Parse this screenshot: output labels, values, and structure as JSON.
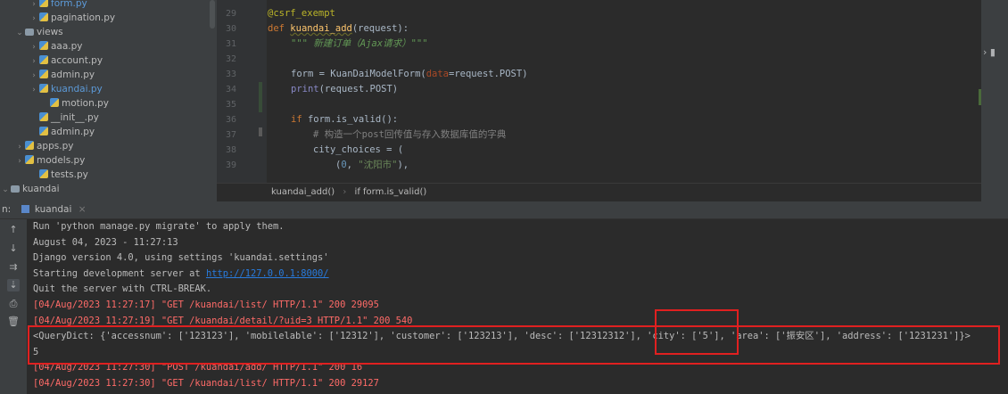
{
  "project_tree": {
    "items": [
      {
        "label": "form.py",
        "type": "file",
        "expand": ">",
        "blue": true
      },
      {
        "label": "pagination.py",
        "type": "file",
        "expand": ">"
      },
      {
        "label": "views",
        "type": "folder",
        "expand": "v"
      },
      {
        "label": "aaa.py",
        "type": "file",
        "expand": ">"
      },
      {
        "label": "account.py",
        "type": "file",
        "expand": ">"
      },
      {
        "label": "admin.py",
        "type": "file",
        "expand": ">"
      },
      {
        "label": "kuandai.py",
        "type": "file",
        "expand": ">",
        "blue": true
      },
      {
        "label": "motion.py",
        "type": "file",
        "expand": ""
      },
      {
        "label": "__init__.py",
        "type": "file",
        "expand": ""
      },
      {
        "label": "admin.py",
        "type": "file",
        "expand": ""
      },
      {
        "label": "apps.py",
        "type": "file",
        "expand": ">"
      },
      {
        "label": "models.py",
        "type": "file",
        "expand": ">"
      },
      {
        "label": "tests.py",
        "type": "file",
        "expand": ""
      },
      {
        "label": "kuandai",
        "type": "folder",
        "expand": "v"
      }
    ]
  },
  "editor": {
    "line_numbers": [
      "29",
      "30",
      "31",
      "32",
      "33",
      "34",
      "35",
      "36",
      "37",
      "38",
      "39"
    ],
    "lines": {
      "l29_decorator": "@csrf_exempt",
      "l30_def": "def ",
      "l30_name": "kuandai_add",
      "l30_rest": "(request):",
      "l31_doc": "\"\"\" 新建订单（Ajax请求）\"\"\"",
      "l33_a": "form = KuanDaiModelForm(",
      "l33_param": "data",
      "l33_b": "=request.POST)",
      "l34_print": "print",
      "l34_rest": "(request.POST)",
      "l36_if": "if ",
      "l36_rest": "form.is_valid():",
      "l37_comment": "# 构造一个post回传值与存入数据库值的字典",
      "l38": "city_choices = (",
      "l39_a": "(",
      "l39_num": "0",
      "l39_b": ", ",
      "l39_str": "\"沈阳市\"",
      "l39_c": "),"
    },
    "breadcrumb": [
      "kuandai_add()",
      "if form.is_valid()"
    ]
  },
  "run_panel": {
    "prefix": "n:",
    "tab_label": "kuandai",
    "tab_close": "×",
    "lines": [
      {
        "text": "Run 'python manage.py migrate' to apply them.",
        "color": "normal"
      },
      {
        "text": "August 04, 2023 - 11:27:13",
        "color": "normal"
      },
      {
        "text": "Django version 4.0, using settings 'kuandai.settings'",
        "color": "normal"
      },
      {
        "text": "Starting development server at ",
        "color": "normal",
        "link": "http://127.0.0.1:8000/"
      },
      {
        "text": "Quit the server with CTRL-BREAK.",
        "color": "normal"
      },
      {
        "text": "[04/Aug/2023 11:27:17] \"GET /kuandai/list/ HTTP/1.1\" 200 29095",
        "color": "red"
      },
      {
        "text": "[04/Aug/2023 11:27:19] \"GET /kuandai/detail/?uid=3 HTTP/1.1\" 200 540",
        "color": "red"
      },
      {
        "text": "<QueryDict: {'accessnum': ['123123'], 'mobilelable': ['12312'], 'customer': ['123213'], 'desc': ['12312312'], 'city': ['5'], 'area': ['振安区'], 'address': ['1231231']}>",
        "color": "normal"
      },
      {
        "text": "5",
        "color": "normal"
      },
      {
        "text": "[04/Aug/2023 11:27:30] \"POST /kuandai/add/ HTTP/1.1\" 200 16",
        "color": "red"
      },
      {
        "text": "[04/Aug/2023 11:27:30] \"GET /kuandai/list/ HTTP/1.1\" 200 29127",
        "color": "red"
      }
    ]
  },
  "colors": {
    "highlight_box": "#e02020",
    "log_red": "#ff6b68",
    "link": "#287bde"
  }
}
